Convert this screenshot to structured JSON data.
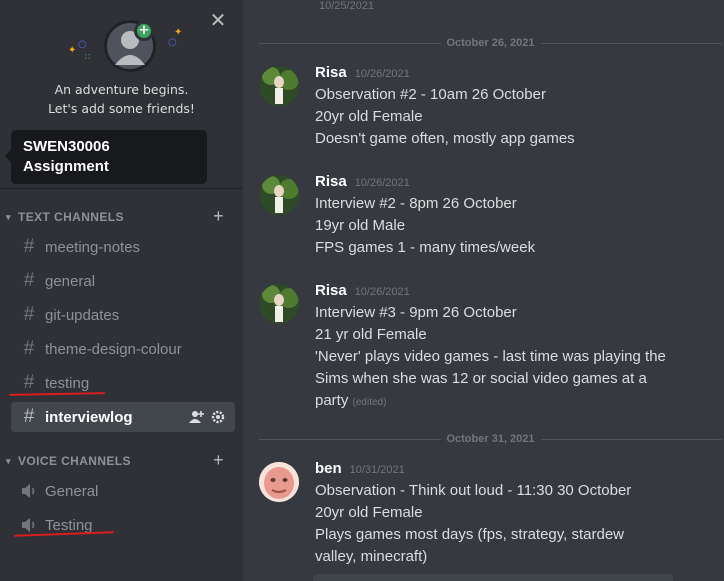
{
  "sidebar": {
    "close_label": "✕",
    "hero_line1": "An adventure begins.",
    "hero_line2": "Let's add some friends!",
    "server_line1": "SWEN30006",
    "server_line2": "Assignment",
    "text_category": "TEXT CHANNELS",
    "voice_category": "VOICE CHANNELS",
    "text_channels": [
      "meeting-notes",
      "general",
      "git-updates",
      "theme-design-colour",
      "testing",
      "interviewlog"
    ],
    "voice_channels": [
      "General",
      "Testing"
    ],
    "active_channel": "interviewlog"
  },
  "chat": {
    "top_timestamp": "10/25/2021",
    "dividers": [
      "October 26, 2021",
      "October 31, 2021"
    ],
    "messages": [
      {
        "author": "Risa",
        "time": "10/26/2021",
        "lines": [
          "Observation #2 - 10am 26 October",
          "20yr old Female",
          "Doesn't game often, mostly app games"
        ]
      },
      {
        "author": "Risa",
        "time": "10/26/2021",
        "lines": [
          "Interview #2 - 8pm 26 October",
          "19yr old Male",
          "FPS games 1 - many times/week"
        ]
      },
      {
        "author": "Risa",
        "time": "10/26/2021",
        "lines": [
          "Interview #3 - 9pm 26 October",
          "21 yr old Female",
          "'Never' plays video games - last time was playing the",
          "Sims when she was 12 or social video games at a",
          "party"
        ],
        "edited": "(edited)"
      },
      {
        "author": "ben",
        "time": "10/31/2021",
        "lines": [
          "Observation - Think out loud - 11:30 30 October",
          "20yr old Female",
          "Plays games most days (fps, strategy, stardew",
          "valley, minecraft)"
        ]
      }
    ]
  },
  "colors": {
    "sidebar_bg": "#2f3136",
    "chat_bg": "#36393f",
    "annotation_red": "#d81e1e",
    "online_green": "#3ba55d"
  }
}
